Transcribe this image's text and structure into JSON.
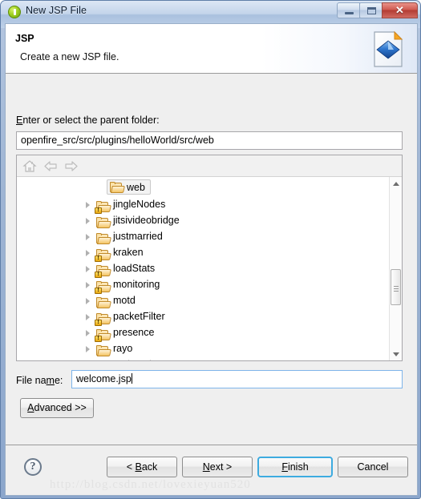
{
  "window": {
    "title": "New JSP File",
    "title_icon": "jsp-wizard-icon",
    "controls": {
      "minimize": "–",
      "maximize": "□",
      "close": "✕"
    }
  },
  "banner": {
    "title": "JSP",
    "description": "Create a new JSP file.",
    "icon": "new-jsp-file-banner-icon"
  },
  "form": {
    "parent_folder_label_prefix": "E",
    "parent_folder_label_rest": "nter or select the parent folder:",
    "parent_folder_value": "openfire_src/src/plugins/helloWorld/src/web",
    "file_name_label_pre": "File na",
    "file_name_label_mnemonic": "m",
    "file_name_label_post": "e:",
    "file_name_value": "welcome.jsp",
    "advanced_label_mnemonic": "A",
    "advanced_label_rest": "dvanced >>"
  },
  "tree": {
    "toolbar": [
      {
        "name": "home-icon",
        "enabled": false
      },
      {
        "name": "back-arrow-icon",
        "enabled": false
      },
      {
        "name": "forward-arrow-icon",
        "enabled": false
      }
    ],
    "root": {
      "label": "web",
      "selected": true,
      "icon": "folder-icon"
    },
    "items": [
      {
        "label": "jingleNodes",
        "icon": "folder-icon",
        "warning": true,
        "expandable": true
      },
      {
        "label": "jitsivideobridge",
        "icon": "folder-icon",
        "warning": false,
        "expandable": true
      },
      {
        "label": "justmarried",
        "icon": "folder-icon",
        "warning": false,
        "expandable": true
      },
      {
        "label": "kraken",
        "icon": "folder-icon",
        "warning": true,
        "expandable": true
      },
      {
        "label": "loadStats",
        "icon": "folder-icon",
        "warning": true,
        "expandable": true
      },
      {
        "label": "monitoring",
        "icon": "folder-icon",
        "warning": true,
        "expandable": true
      },
      {
        "label": "motd",
        "icon": "folder-icon",
        "warning": false,
        "expandable": true
      },
      {
        "label": "packetFilter",
        "icon": "folder-icon",
        "warning": true,
        "expandable": true
      },
      {
        "label": "presence",
        "icon": "folder-icon",
        "warning": true,
        "expandable": true
      },
      {
        "label": "rayo",
        "icon": "folder-icon",
        "warning": false,
        "expandable": true
      },
      {
        "label": "registration",
        "icon": "folder-icon",
        "warning": false,
        "expandable": true,
        "clipped": true
      }
    ],
    "scrollbar": {
      "up": "▲",
      "down": "▼",
      "position": "middle"
    }
  },
  "footer": {
    "help": "?",
    "buttons": [
      {
        "name": "back-button",
        "label": "< Back",
        "mnemonic": "B",
        "default": false
      },
      {
        "name": "next-button",
        "label": "Next >",
        "mnemonic": "N",
        "default": false
      },
      {
        "name": "finish-button",
        "label": "Finish",
        "mnemonic": "F",
        "default": true
      },
      {
        "name": "cancel-button",
        "label": "Cancel",
        "mnemonic": "",
        "default": false
      }
    ]
  },
  "watermark": "http://blog.csdn.net/lovexieyuan520",
  "colors": {
    "frame": "#8ba6cc",
    "dialog_bg": "#efefef",
    "banner_bg": "#ffffff",
    "focus_border": "#3dabe0",
    "close_button": "#b33c33",
    "folder": "#f4c464",
    "diamond": "#2a6fd0"
  }
}
